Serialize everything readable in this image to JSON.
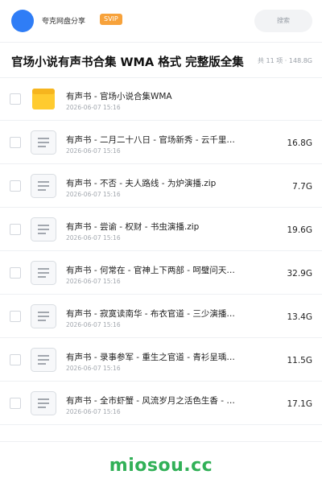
{
  "header": {
    "share_name": "夸克网盘分享",
    "badge": "SVIP",
    "search_placeholder": "搜索",
    "accent_color": "#2f7df6",
    "badge_color": "#f7a23b"
  },
  "page": {
    "title": "官场小说有声书合集 WMA 格式 完整版全集",
    "meta": "共 11 项 · 148.8G"
  },
  "files": [
    {
      "name": "有声书 - 官场小说合集WMA",
      "date": "2026-06-07 15:16",
      "size": "",
      "type": "folder-icon"
    },
    {
      "name": "有声书 - 二月二十八日 - 官场新秀 - 云千里…",
      "date": "2026-06-07 15:16",
      "size": "16.8G",
      "type": "file-icon"
    },
    {
      "name": "有声书 - 不否 - 夫人路线 - 为炉演播.zip",
      "date": "2026-06-07 15:16",
      "size": "7.7G",
      "type": "file-icon"
    },
    {
      "name": "有声书 - 尝谕 - 权财 - 书虫演播.zip",
      "date": "2026-06-07 15:16",
      "size": "19.6G",
      "type": "file-icon"
    },
    {
      "name": "有声书 - 何常在 - 官神上下两部 - 呵璧问天…",
      "date": "2026-06-07 15:16",
      "size": "32.9G",
      "type": "file-icon"
    },
    {
      "name": "有声书 - 寂寞读南华 - 布衣官道 - 三少演播…",
      "date": "2026-06-07 15:16",
      "size": "13.4G",
      "type": "file-icon"
    },
    {
      "name": "有声书 - 录事参军 - 重生之官道 - 青衫呈瑀…",
      "date": "2026-06-07 15:16",
      "size": "11.5G",
      "type": "file-icon"
    },
    {
      "name": "有声书 - 全市虾蟹 - 风流岁月之活色生香 - …",
      "date": "2026-06-07 15:16",
      "size": "17.1G",
      "type": "file-icon"
    }
  ],
  "footer": {
    "brand": "miosou.cc",
    "brand_color": "#31b057"
  }
}
